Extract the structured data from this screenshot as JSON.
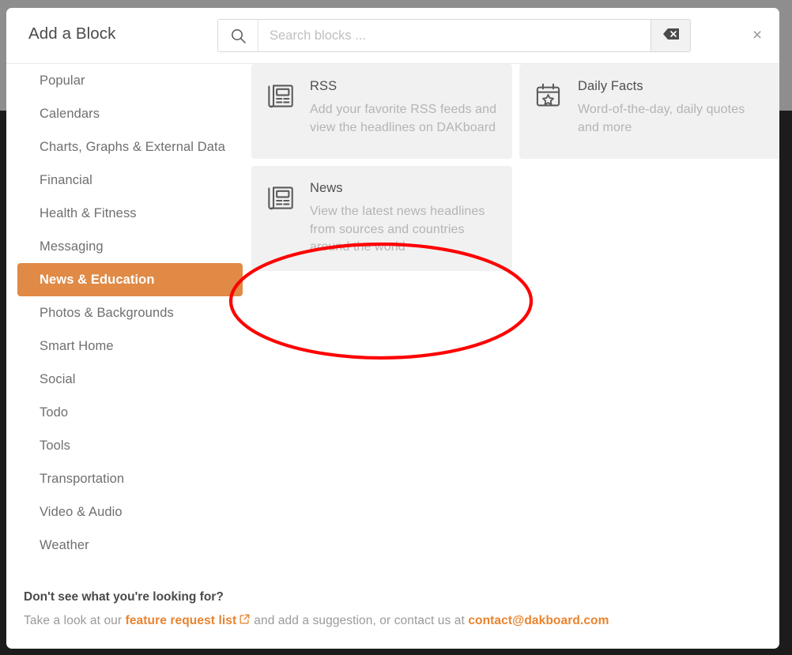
{
  "modal": {
    "title": "Add a Block",
    "close_label": "×",
    "close_icon": "close-icon"
  },
  "search": {
    "placeholder": "Search blocks ...",
    "value": "",
    "search_icon": "search-icon",
    "clear_icon": "backspace-icon"
  },
  "sidebar": {
    "items": [
      {
        "label": "Popular",
        "active": false
      },
      {
        "label": "Calendars",
        "active": false
      },
      {
        "label": "Charts, Graphs & External Data",
        "active": false
      },
      {
        "label": "Financial",
        "active": false
      },
      {
        "label": "Health & Fitness",
        "active": false
      },
      {
        "label": "Messaging",
        "active": false
      },
      {
        "label": "News & Education",
        "active": true
      },
      {
        "label": "Photos & Backgrounds",
        "active": false
      },
      {
        "label": "Smart Home",
        "active": false
      },
      {
        "label": "Social",
        "active": false
      },
      {
        "label": "Todo",
        "active": false
      },
      {
        "label": "Tools",
        "active": false
      },
      {
        "label": "Transportation",
        "active": false
      },
      {
        "label": "Video & Audio",
        "active": false
      },
      {
        "label": "Weather",
        "active": false
      }
    ]
  },
  "blocks": [
    {
      "title": "RSS",
      "description": "Add your favorite RSS feeds and view the headlines on DAKboard",
      "icon": "newspaper-icon"
    },
    {
      "title": "Daily Facts",
      "description": "Word-of-the-day, daily quotes and more",
      "icon": "calendar-star-icon"
    },
    {
      "title": "News",
      "description": "View the latest news headlines from sources and countries around the world",
      "icon": "newspaper-icon"
    }
  ],
  "footer": {
    "title": "Don't see what you're looking for?",
    "text_before": "Take a look at our",
    "link_feature": "feature request list",
    "external_icon": "external-link-icon",
    "text_middle": "and add a suggestion, or contact us at",
    "link_email": "contact@dakboard.com"
  },
  "annotation": {
    "shape": "ellipse",
    "color": "#FF0000",
    "target": "News"
  },
  "colors": {
    "accent_orange": "#E08A46",
    "link_orange": "#E8832E",
    "card_bg": "#F1F1F1",
    "annotation_red": "#FF0000"
  }
}
